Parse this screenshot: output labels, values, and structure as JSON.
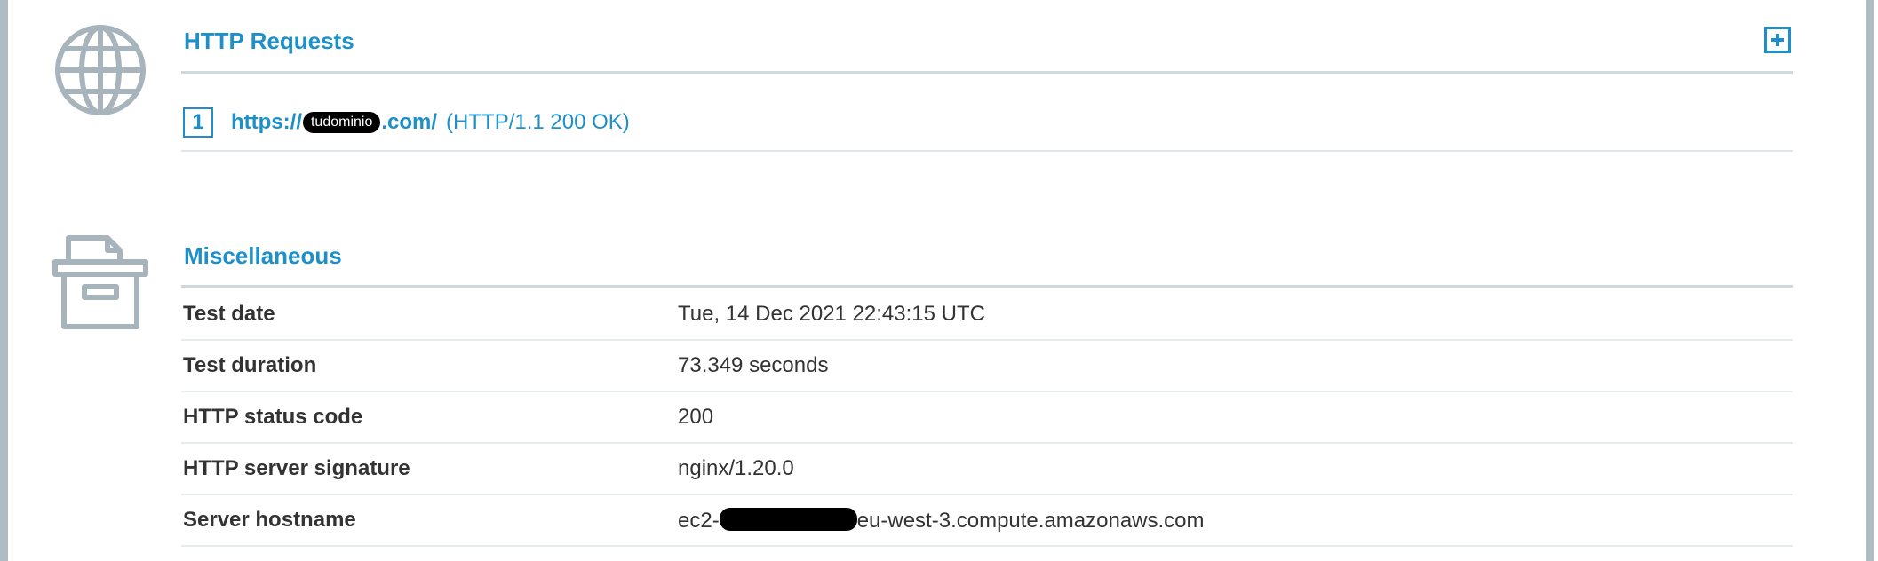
{
  "colors": {
    "accent": "#1e90c8",
    "icon": "#a7b4bb",
    "rule": "#cfd8dc",
    "frame": "#aebcc3",
    "text": "#333333"
  },
  "http_requests": {
    "title": "HTTP Requests",
    "icon": "globe-icon",
    "expand_icon": "plus-square-icon",
    "requests": [
      {
        "number": "1",
        "url_prefix": "https://",
        "url_redacted_label": "tudominio",
        "url_suffix": ".com/",
        "status": "(HTTP/1.1 200 OK)"
      }
    ]
  },
  "miscellaneous": {
    "title": "Miscellaneous",
    "icon": "archive-box-icon",
    "rows": [
      {
        "label": "Test date",
        "value": "Tue, 14 Dec 2021 22:43:15 UTC"
      },
      {
        "label": "Test duration",
        "value": "73.349 seconds"
      },
      {
        "label": "HTTP status code",
        "value": "200"
      },
      {
        "label": "HTTP server signature",
        "value": "nginx/1.20.0"
      },
      {
        "label": "Server hostname",
        "value_prefix": "ec2-",
        "value_suffix": "eu-west-3.compute.amazonaws.com"
      }
    ]
  }
}
